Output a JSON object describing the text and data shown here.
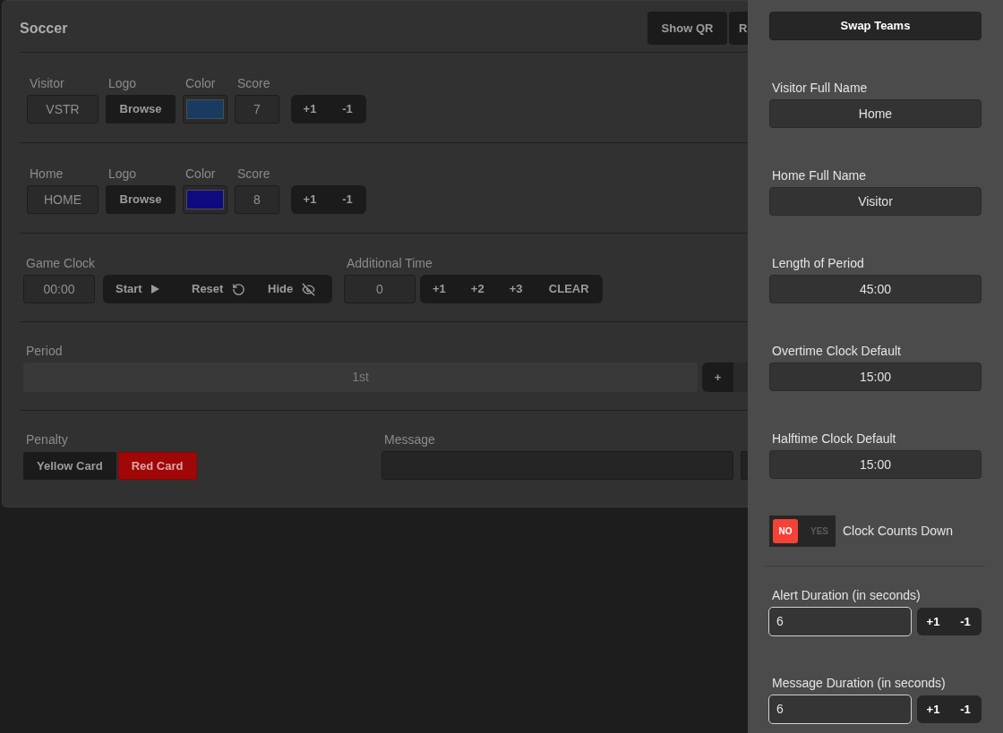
{
  "header": {
    "title": "Soccer",
    "buttons": [
      "Show QR",
      "R"
    ]
  },
  "teams": [
    {
      "label": "Visitor",
      "abbreviation": "VSTR",
      "logo_label": "Logo",
      "logo_button": "Browse",
      "color_label": "Color",
      "color": "#193b5f",
      "score_label": "Score",
      "score": "7",
      "score_buttons": [
        "+1",
        "-1"
      ]
    },
    {
      "label": "Home",
      "abbreviation": "HOME",
      "logo_label": "Logo",
      "logo_button": "Browse",
      "color_label": "Color",
      "color": "#0f0a80",
      "score_label": "Score",
      "score": "8",
      "score_buttons": [
        "+1",
        "-1"
      ]
    }
  ],
  "game_clock": {
    "label": "Game Clock",
    "value": "00:00",
    "buttons": [
      "Start",
      "Reset",
      "Hide"
    ]
  },
  "additional_time": {
    "label": "Additional Time",
    "value": "0",
    "buttons": [
      "+1",
      "+2",
      "+3",
      "CLEAR"
    ]
  },
  "period": {
    "label": "Period",
    "value": "1st",
    "buttons": [
      "+"
    ]
  },
  "penalty": {
    "label": "Penalty",
    "buttons": [
      {
        "label": "Yellow Card",
        "selected": false
      },
      {
        "label": "Red Card",
        "selected": true
      }
    ]
  },
  "message": {
    "label": "Message"
  },
  "settings": {
    "swap_button": "Swap Teams",
    "fields": [
      {
        "label": "Visitor Full Name",
        "value": "Home"
      },
      {
        "label": "Home Full Name",
        "value": "Visitor"
      },
      {
        "label": "Length of Period",
        "value": "45:00"
      },
      {
        "label": "Overtime Clock Default",
        "value": "15:00"
      },
      {
        "label": "Halftime Clock Default",
        "value": "15:00"
      }
    ],
    "clock_counts_down": {
      "label": "Clock Counts Down",
      "on": false,
      "off_text": "NO",
      "on_text": "YES"
    },
    "durations": [
      {
        "label": "Alert Duration (in seconds)",
        "value": "6",
        "buttons": [
          "+1",
          "-1"
        ]
      },
      {
        "label": "Message Duration (in seconds)",
        "value": "6",
        "buttons": [
          "+1",
          "-1"
        ]
      }
    ]
  }
}
